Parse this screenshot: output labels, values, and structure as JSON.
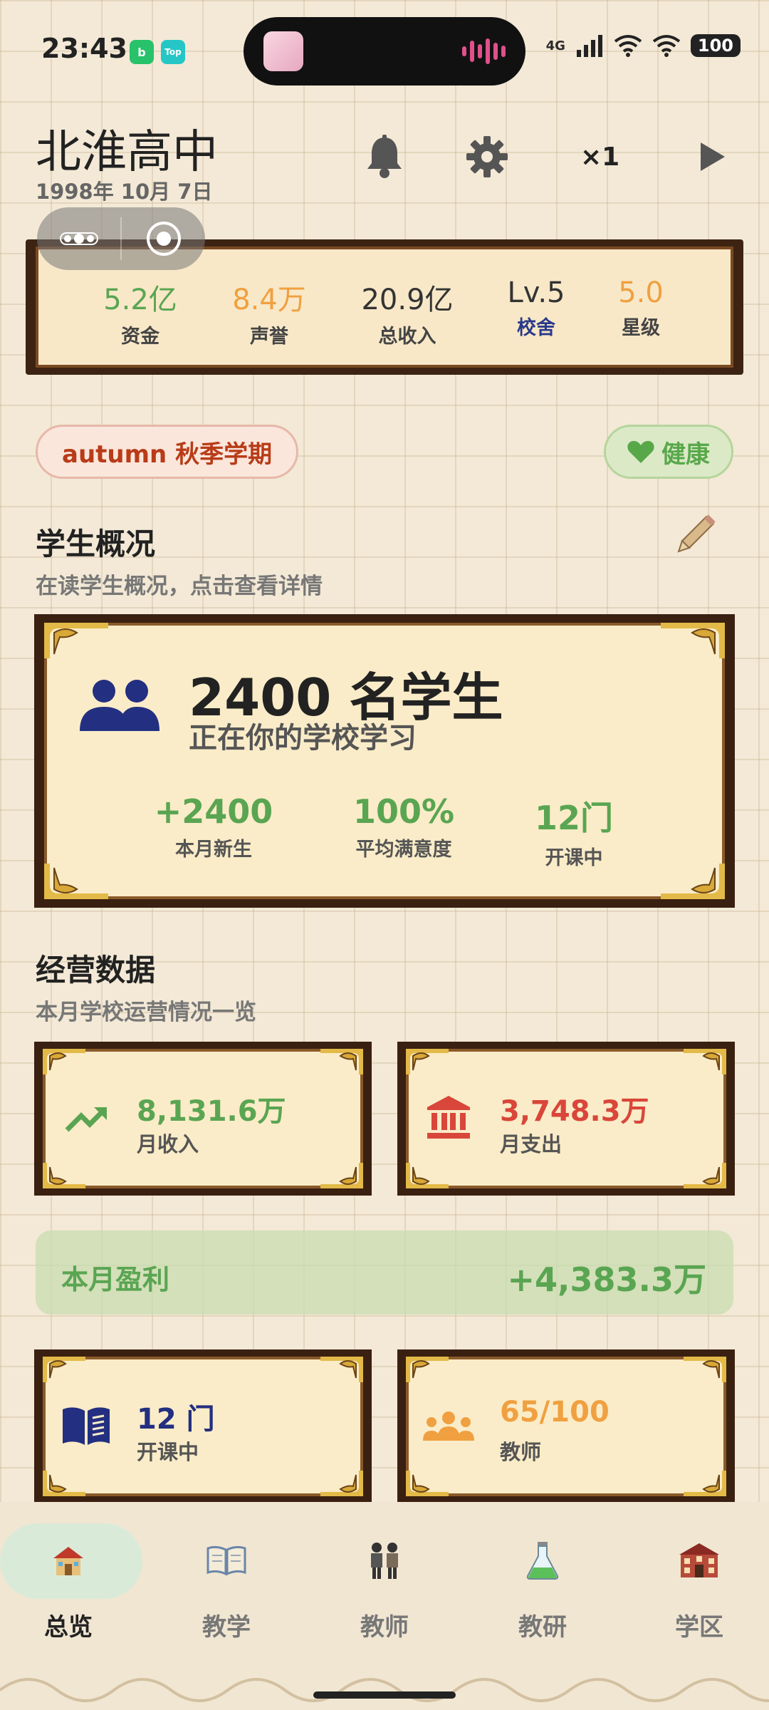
{
  "status_bar": {
    "time": "23:43",
    "app_badge_1": "b",
    "app_badge_2": "Top",
    "network": "4G",
    "battery": "100"
  },
  "header": {
    "school_name": "北淮高中",
    "date": "1998年 10月 7日",
    "speed": "×1"
  },
  "stats": [
    {
      "value": "5.2亿",
      "label": "资金",
      "value_color": "#5aa552",
      "label_color": "#444"
    },
    {
      "value": "8.4万",
      "label": "声誉",
      "value_color": "#f0a040",
      "label_color": "#444"
    },
    {
      "value": "20.9亿",
      "label": "总收入",
      "value_color": "#333333",
      "label_color": "#444"
    },
    {
      "value": "Lv.5",
      "label": "校舍",
      "value_color": "#333333",
      "label_color": "#2a3a8a"
    },
    {
      "value": "5.0",
      "label": "星级",
      "value_color": "#f0a040",
      "label_color": "#444"
    }
  ],
  "season_badge": "autumn 秋季学期",
  "health_badge": "健康",
  "students_section": {
    "title": "学生概况",
    "subtitle": "在读学生概况，点击查看详情",
    "count": "2400 名学生",
    "description": "正在你的学校学习",
    "metrics": [
      {
        "value": "+2400",
        "label": "本月新生"
      },
      {
        "value": "100%",
        "label": "平均满意度"
      },
      {
        "value": "12门",
        "label": "开课中"
      }
    ]
  },
  "operations_section": {
    "title": "经营数据",
    "subtitle": "本月学校运营情况一览",
    "income_value": "8,131.6万",
    "income_label": "月收入",
    "expense_value": "3,748.3万",
    "expense_label": "月支出",
    "profit_label": "本月盈利",
    "profit_value": "+4,383.3万",
    "courses_value": "12 门",
    "courses_label": "开课中",
    "teachers_value": "65/100",
    "teachers_label": "教师"
  },
  "colors": {
    "green": "#5aa552",
    "red": "#d9463a",
    "orange": "#f0a040",
    "navy": "#232f80",
    "frame_dark": "#3a2010",
    "card_bg": "#faecc8"
  },
  "bottom_nav": [
    {
      "label": "总览",
      "icon": "school-house-icon",
      "active": true
    },
    {
      "label": "教学",
      "icon": "open-book-icon",
      "active": false
    },
    {
      "label": "教师",
      "icon": "teachers-icon",
      "active": false
    },
    {
      "label": "教研",
      "icon": "flask-icon",
      "active": false
    },
    {
      "label": "学区",
      "icon": "campus-building-icon",
      "active": false
    }
  ]
}
